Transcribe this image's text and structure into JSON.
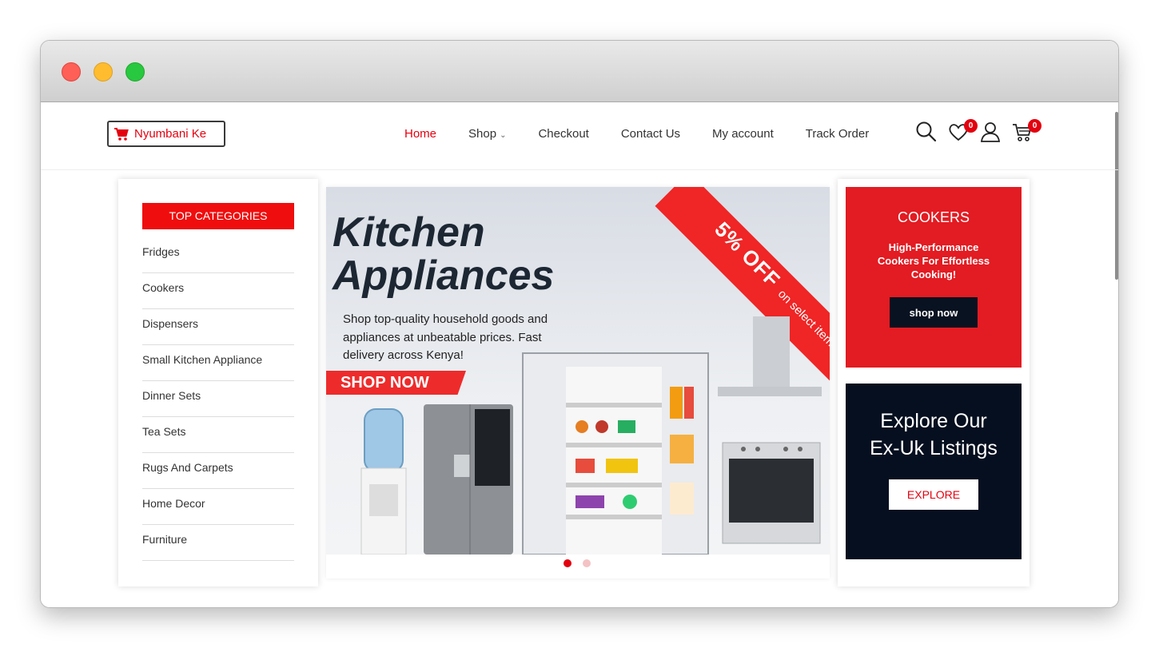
{
  "window": {
    "controls": [
      "close",
      "minimize",
      "maximize"
    ]
  },
  "header": {
    "logo_text": "Nyumbani Ke",
    "nav": [
      {
        "label": "Home",
        "active": true
      },
      {
        "label": "Shop",
        "dropdown": true
      },
      {
        "label": "Checkout"
      },
      {
        "label": "Contact Us"
      },
      {
        "label": "My account"
      },
      {
        "label": "Track Order"
      }
    ],
    "wishlist_count": "0",
    "cart_count": "0"
  },
  "sidebar": {
    "title": "TOP CATEGORIES",
    "categories": [
      "Fridges",
      "Cookers",
      "Dispensers",
      "Small Kitchen Appliance",
      "Dinner Sets",
      "Tea Sets",
      "Rugs And Carpets",
      "Home Decor",
      "Furniture"
    ]
  },
  "hero": {
    "title_line1": "Kitchen",
    "title_line2": "Appliances",
    "text": "Shop top-quality household goods and appliances at unbeatable prices. Fast delivery across Kenya!",
    "cta": "SHOP NOW",
    "ribbon_big": "5% OFF",
    "ribbon_small": "on select items",
    "slides": 2,
    "active_slide": 1
  },
  "promo_cookers": {
    "title": "COOKERS",
    "text": "High-Performance Cookers For Effortless Cooking!",
    "button": "shop now"
  },
  "promo_exuk": {
    "title": "Explore Our Ex-Uk Listings",
    "button": "EXPLORE"
  },
  "colors": {
    "brand_red": "#e3000f",
    "navy": "#050f1f"
  }
}
